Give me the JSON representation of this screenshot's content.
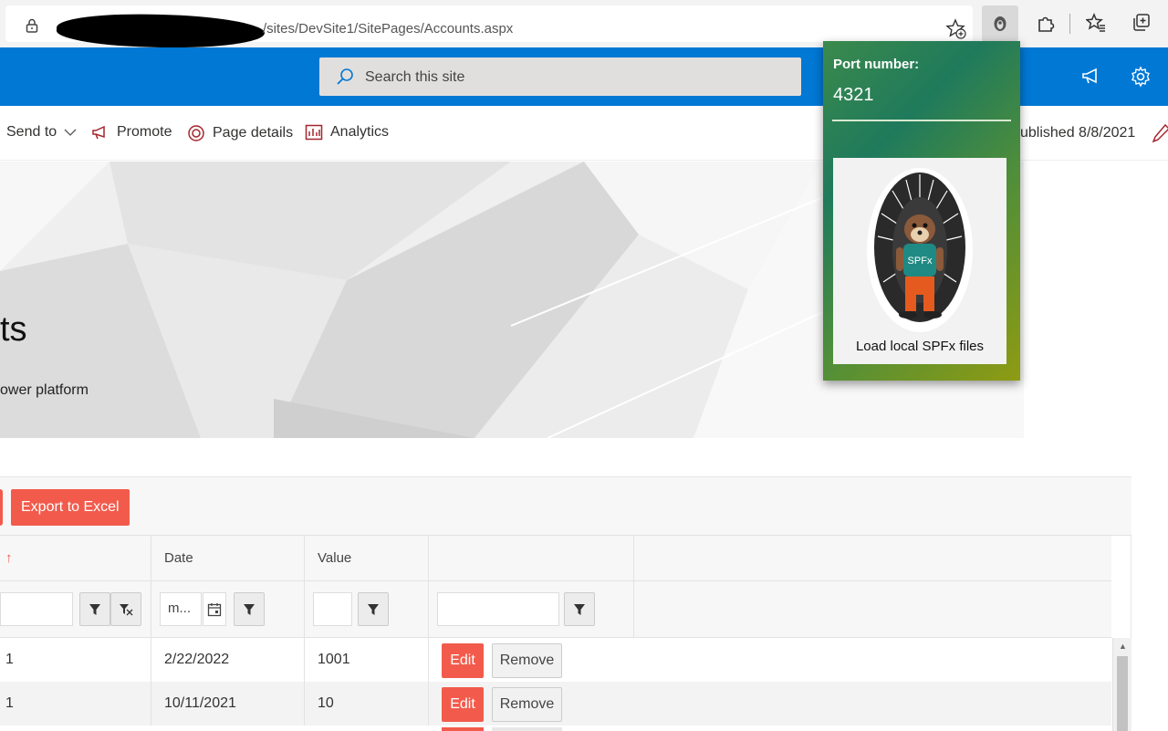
{
  "browser": {
    "url_path": "/sites/DevSite1/SitePages/Accounts.aspx"
  },
  "suitebar": {
    "search_placeholder": "Search this site"
  },
  "commandbar": {
    "send_to": "Send to",
    "promote": "Promote",
    "page_details": "Page details",
    "analytics": "Analytics",
    "published": "ublished 8/8/2021"
  },
  "hero": {
    "title": "ts",
    "subtitle": "ower platform"
  },
  "grid": {
    "export_label": "Export to Excel",
    "sort_indicator": "↑",
    "columns": [
      "Date",
      "Value"
    ],
    "date_filter_value": "m...",
    "rows": [
      {
        "id": "1",
        "date": "2/22/2022",
        "value": "1001"
      },
      {
        "id": "1",
        "date": "10/11/2021",
        "value": "10"
      }
    ],
    "edit_label": "Edit",
    "remove_label": "Remove"
  },
  "popup": {
    "port_label": "Port number:",
    "port_value": "4321",
    "mascot_text": "SPFx",
    "cta": "Load local SPFx files"
  },
  "colors": {
    "suitebar": "#0078d4",
    "accent_button": "#f25b4c",
    "popup_green": "#1f7a5c",
    "popup_olive": "#8f9b12"
  }
}
